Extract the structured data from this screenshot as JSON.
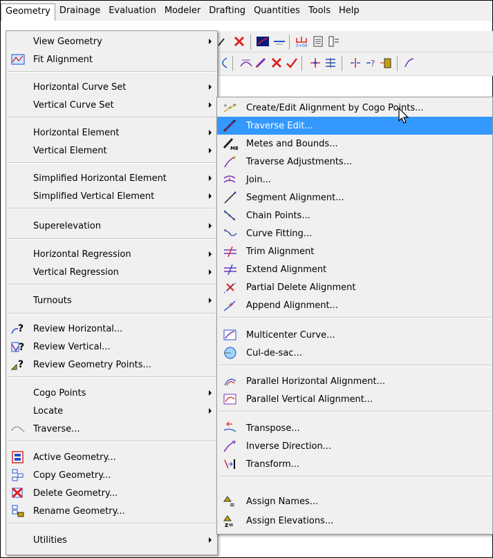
{
  "menubar": {
    "items": [
      "Geometry",
      "Drainage",
      "Evaluation",
      "Modeler",
      "Drafting",
      "Quantities",
      "Tools",
      "Help"
    ]
  },
  "geometry_menu": {
    "items": [
      {
        "label": "View Geometry",
        "submenu": true,
        "icon": ""
      },
      {
        "label": "Fit Alignment",
        "submenu": false,
        "icon": "fit-alignment-icon"
      },
      {
        "label": "Horizontal Curve Set",
        "submenu": true,
        "icon": ""
      },
      {
        "label": "Vertical Curve Set",
        "submenu": true,
        "icon": ""
      },
      {
        "label": "Horizontal Element",
        "submenu": true,
        "icon": ""
      },
      {
        "label": "Vertical Element",
        "submenu": true,
        "icon": ""
      },
      {
        "label": "Simplified Horizontal Element",
        "submenu": true,
        "icon": ""
      },
      {
        "label": "Simplified Vertical Element",
        "submenu": true,
        "icon": ""
      },
      {
        "label": "Superelevation",
        "submenu": true,
        "icon": ""
      },
      {
        "label": "Horizontal Regression",
        "submenu": true,
        "icon": ""
      },
      {
        "label": "Vertical Regression",
        "submenu": true,
        "icon": ""
      },
      {
        "label": "Turnouts",
        "submenu": true,
        "icon": ""
      },
      {
        "label": "Review Horizontal...",
        "submenu": false,
        "icon": "review-horizontal-icon"
      },
      {
        "label": "Review Vertical...",
        "submenu": false,
        "icon": "review-vertical-icon"
      },
      {
        "label": "Review Geometry Points...",
        "submenu": false,
        "icon": "review-points-icon"
      },
      {
        "label": "Cogo Points",
        "submenu": true,
        "icon": ""
      },
      {
        "label": "Locate",
        "submenu": true,
        "icon": ""
      },
      {
        "label": "Traverse...",
        "submenu": false,
        "icon": "traverse-icon"
      },
      {
        "label": "Active Geometry...",
        "submenu": false,
        "icon": "active-geometry-icon"
      },
      {
        "label": "Copy Geometry...",
        "submenu": false,
        "icon": "copy-geometry-icon"
      },
      {
        "label": "Delete Geometry...",
        "submenu": false,
        "icon": "delete-geometry-icon"
      },
      {
        "label": "Rename Geometry...",
        "submenu": false,
        "icon": "rename-geometry-icon"
      },
      {
        "label": "Utilities",
        "submenu": true,
        "icon": ""
      }
    ]
  },
  "horizontal_element_submenu": {
    "items": [
      {
        "label": "Create/Edit Alignment by Cogo Points...",
        "icon": "cogo-points-alignment-icon"
      },
      {
        "label": "Traverse Edit...",
        "icon": "traverse-edit-icon",
        "highlighted": true
      },
      {
        "label": "Metes and Bounds...",
        "icon": "metes-bounds-icon"
      },
      {
        "label": "Traverse Adjustments...",
        "icon": "traverse-adjust-icon"
      },
      {
        "label": "Join...",
        "icon": "join-icon"
      },
      {
        "label": "Segment Alignment...",
        "icon": "segment-alignment-icon"
      },
      {
        "label": "Chain Points...",
        "icon": "chain-points-icon"
      },
      {
        "label": "Curve Fitting...",
        "icon": "curve-fitting-icon"
      },
      {
        "label": "Trim Alignment",
        "icon": "trim-alignment-icon"
      },
      {
        "label": "Extend Alignment",
        "icon": "extend-alignment-icon"
      },
      {
        "label": "Partial Delete Alignment",
        "icon": "partial-delete-icon"
      },
      {
        "label": "Append Alignment...",
        "icon": "append-alignment-icon"
      },
      {
        "label": "Multicenter Curve...",
        "icon": "multicenter-curve-icon"
      },
      {
        "label": "Cul-de-sac...",
        "icon": "cul-de-sac-icon"
      },
      {
        "label": "Parallel Horizontal Alignment...",
        "icon": "parallel-horizontal-icon"
      },
      {
        "label": "Parallel Vertical Alignment...",
        "icon": "parallel-vertical-icon"
      },
      {
        "label": "Transpose...",
        "icon": "transpose-icon"
      },
      {
        "label": "Inverse Direction...",
        "icon": "inverse-direction-icon"
      },
      {
        "label": "Transform...",
        "icon": "transform-icon"
      },
      {
        "label": "Assign Names...",
        "icon": "assign-names-icon"
      },
      {
        "label": "Assign Elevations...",
        "icon": "assign-elevations-icon"
      }
    ]
  },
  "colors": {
    "highlight": "#3399ff",
    "menu_bg": "#f0f0f0",
    "icon_red": "#e02020",
    "icon_purple": "#7a2fb5",
    "icon_blue": "#1f4fd0"
  }
}
